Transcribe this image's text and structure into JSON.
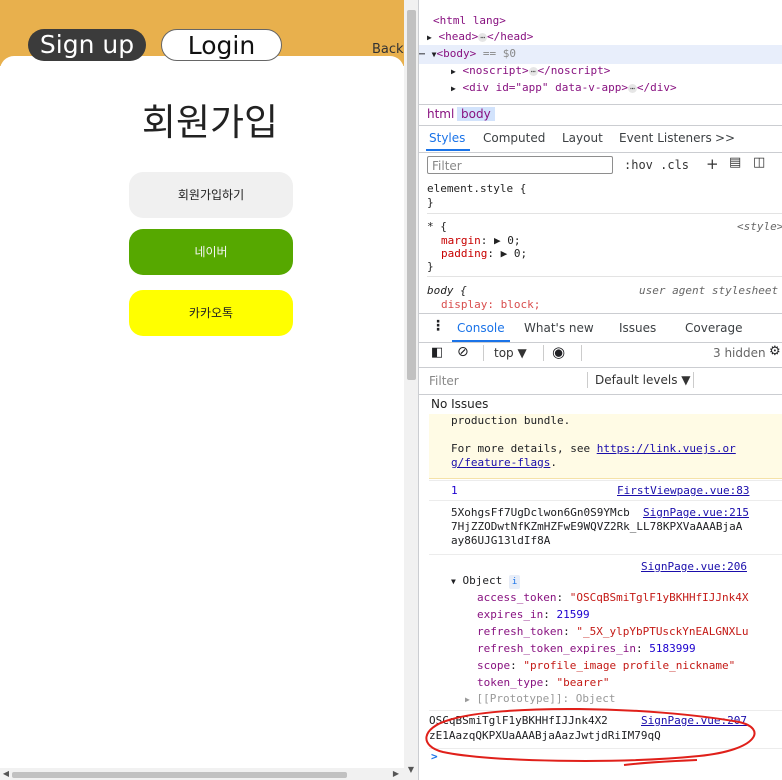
{
  "page": {
    "header": {
      "signup_tab": "Sign up",
      "login_tab": "Login",
      "back_link": "Back"
    },
    "heading": "회원가입",
    "buttons": {
      "signup": "회원가입하기",
      "naver": "네이버",
      "kakao": "카카오톡"
    },
    "colors": {
      "header_bg": "#e8b04d",
      "naver": "#56a800",
      "kakao": "#ffff00"
    }
  },
  "devtools": {
    "dom": {
      "html_open": "<html lang>",
      "head": "<head>",
      "head_close": "</head>",
      "body": "<body>",
      "body_suffix": "== $0",
      "noscript": "<noscript>",
      "noscript_close": "</noscript>",
      "app_div": "<div id=\"app\" data-v-app>",
      "app_div_close": "</div>"
    },
    "breadcrumb": [
      "html",
      "body"
    ],
    "styles_tabs": [
      "Styles",
      "Computed",
      "Layout",
      "Event Listeners",
      ">>"
    ],
    "styles_filter_placeholder": "Filter",
    "hov_cls": ":hov  .cls",
    "styles": {
      "element_style": "element.style {",
      "close_brace": "}",
      "universal_selector": "* {",
      "style_source": "<style>",
      "margin_prop": "margin",
      "margin_val": "▶ 0;",
      "padding_prop": "padding",
      "padding_val": "▶ 0;",
      "body_selector": "body {",
      "ua_source": "user agent stylesheet",
      "display_line": "display: block;"
    },
    "console_tabs": [
      "Console",
      "What's new",
      "Issues",
      "Coverage"
    ],
    "console_toolbar": {
      "context": "top ▼",
      "hidden": "3 hidden"
    },
    "console_filter_placeholder": "Filter",
    "levels": "Default levels ▼",
    "no_issues": "No Issues",
    "console": {
      "warn_line1": "production bundle.",
      "warn_line2": "For more details, see ",
      "warn_link": "https://link.vuejs.or",
      "warn_link2": "g/feature-flags",
      "warn_dot": ".",
      "log1_value": "1",
      "log1_source": "FirstViewpage.vue:83",
      "log2_line1": "5XohgsFf7UgDclwon6Gn0S9YMcb",
      "log2_source": "SignPage.vue:215",
      "log2_line2": "7HjZZODwtNfKZmHZFwE9WQVZ2Rk_LL78KPXVaAAABjaA",
      "log2_line3": "ay86UJG13ldIf8A",
      "log3_source": "SignPage.vue:206",
      "object_label": "Object",
      "object_fields": [
        {
          "key": "access_token",
          "value": "\"OSCqBSmiTglF1yBKHHfIJJnk4X"
        },
        {
          "key": "expires_in",
          "value": "21599"
        },
        {
          "key": "refresh_token",
          "value": "\"_5X_ylpYbPTUsckYnEALGNXLu"
        },
        {
          "key": "refresh_token_expires_in",
          "value": "5183999"
        },
        {
          "key": "scope",
          "value": "\"profile_image profile_nickname\""
        },
        {
          "key": "token_type",
          "value": "\"bearer\""
        }
      ],
      "prototype": "[[Prototype]]: Object",
      "log4_line1": "OSCqBSmiTglF1yBKHHfIJJnk4X2",
      "log4_source": "SignPage.vue:207",
      "log4_line2": "zE1AazqQKPXUaAAABjaAazJwtjdRiIM79qQ",
      "prompt": ">"
    },
    "annotation_color": "#e0201a"
  }
}
